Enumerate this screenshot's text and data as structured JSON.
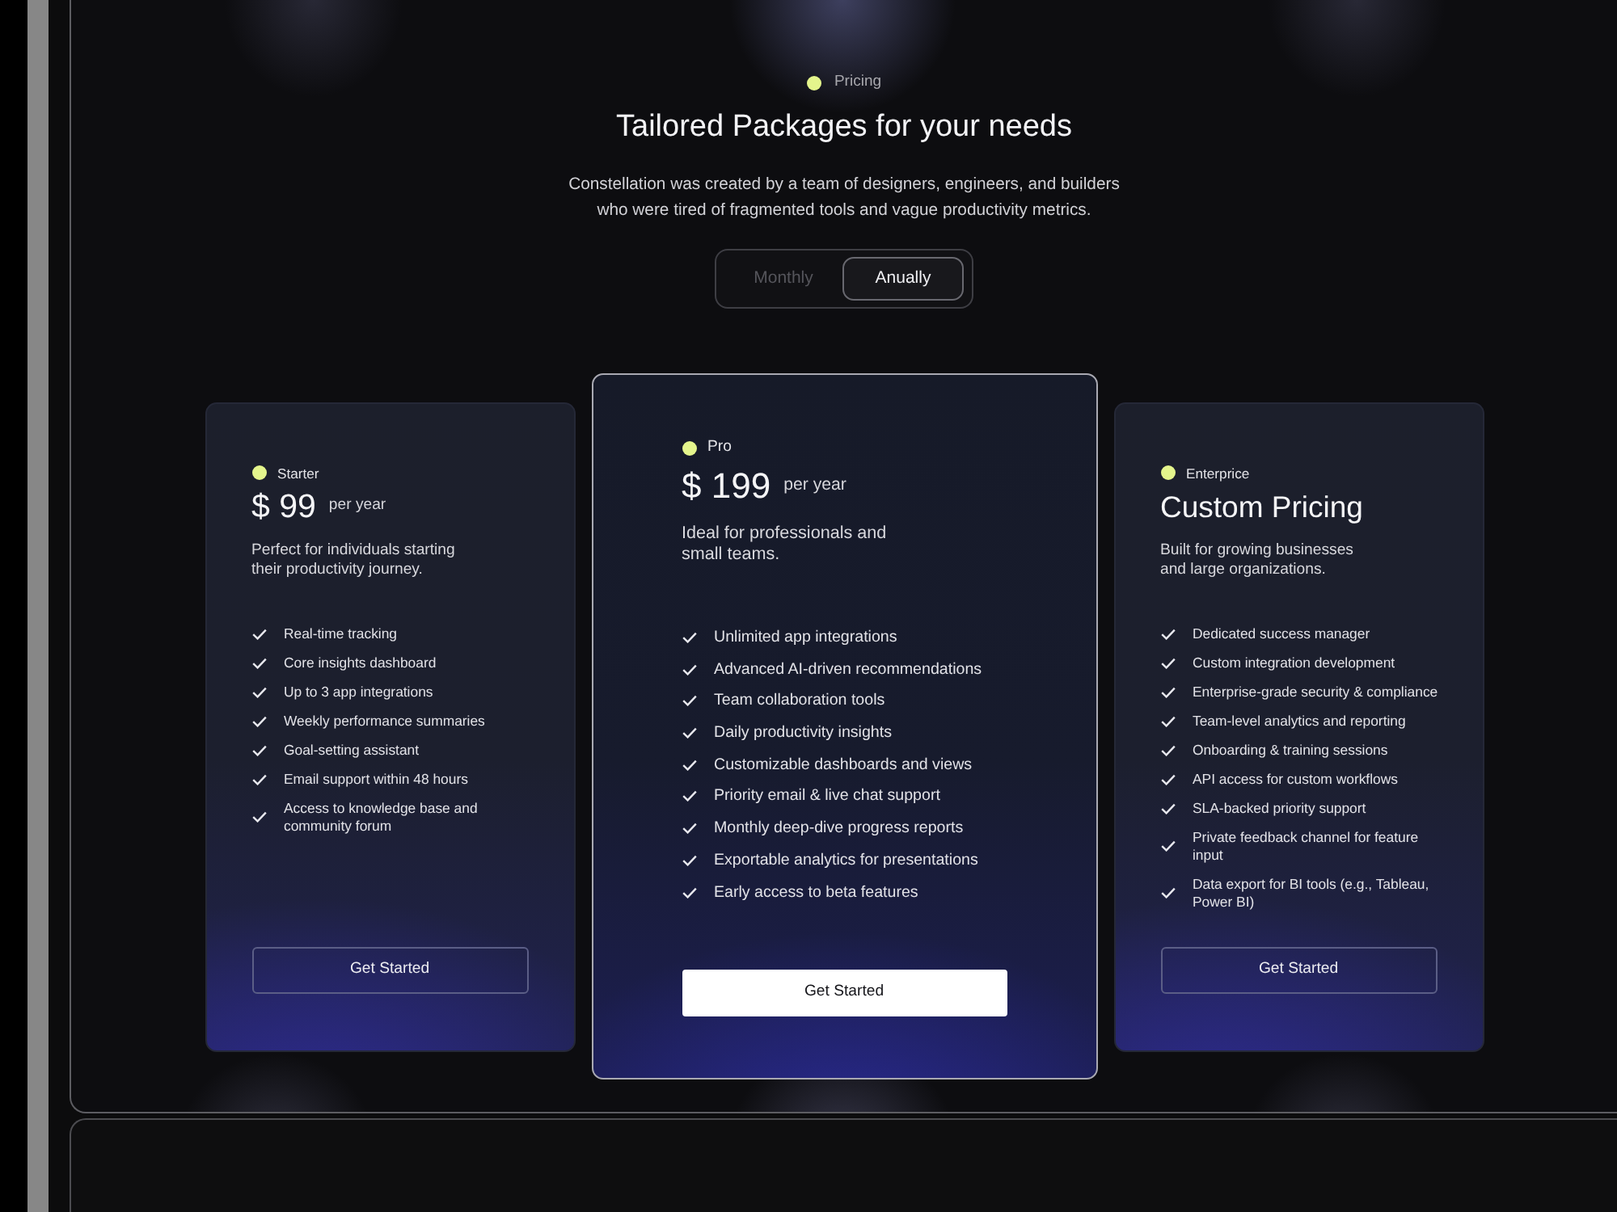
{
  "section": {
    "eyebrow": "Pricing",
    "title": "Tailored Packages for your needs",
    "description": "Constellation was created by a team of designers, engineers, and builders\nwho were tired of fragmented tools and vague productivity metrics."
  },
  "billing_toggle": [
    {
      "label": "Monthly",
      "selected": false
    },
    {
      "label": "Anually",
      "selected": true
    }
  ],
  "plans": [
    {
      "name": "Starter",
      "price": "$ 99",
      "period": "per year",
      "description": "Perfect for individuals starting\ntheir productivity journey.",
      "featured": false,
      "features": [
        "Real-time tracking",
        "Core insights dashboard",
        "Up to 3 app integrations",
        "Weekly performance summaries",
        "Goal-setting assistant",
        "Email support within 48 hours",
        "Access to knowledge base and\ncommunity forum"
      ],
      "button": "Get Started"
    },
    {
      "name": "Pro",
      "price": "$ 199",
      "period": "per year",
      "description": "Ideal for professionals and\nsmall teams.",
      "featured": true,
      "features": [
        "Unlimited app integrations",
        "Advanced AI-driven recommendations",
        "Team collaboration tools",
        "Daily productivity insights",
        "Customizable dashboards and views",
        "Priority email & live chat support",
        "Monthly deep-dive progress reports",
        "Exportable analytics for presentations",
        "Early access to beta features"
      ],
      "button": "Get Started"
    },
    {
      "name": "Enterprice",
      "price": "Custom Pricing",
      "description": "Built for growing businesses\nand large organizations.",
      "featured": false,
      "features": [
        "Dedicated success manager",
        "Custom integration development",
        "Enterprise-grade security & compliance",
        "Team-level analytics and reporting",
        "Onboarding & training sessions",
        "API access for custom workflows",
        "SLA-backed priority support",
        "Private feedback channel for feature\ninput",
        "Data export for BI tools (e.g., Tableau,\nPower BI)"
      ],
      "button": "Get Started"
    }
  ]
}
